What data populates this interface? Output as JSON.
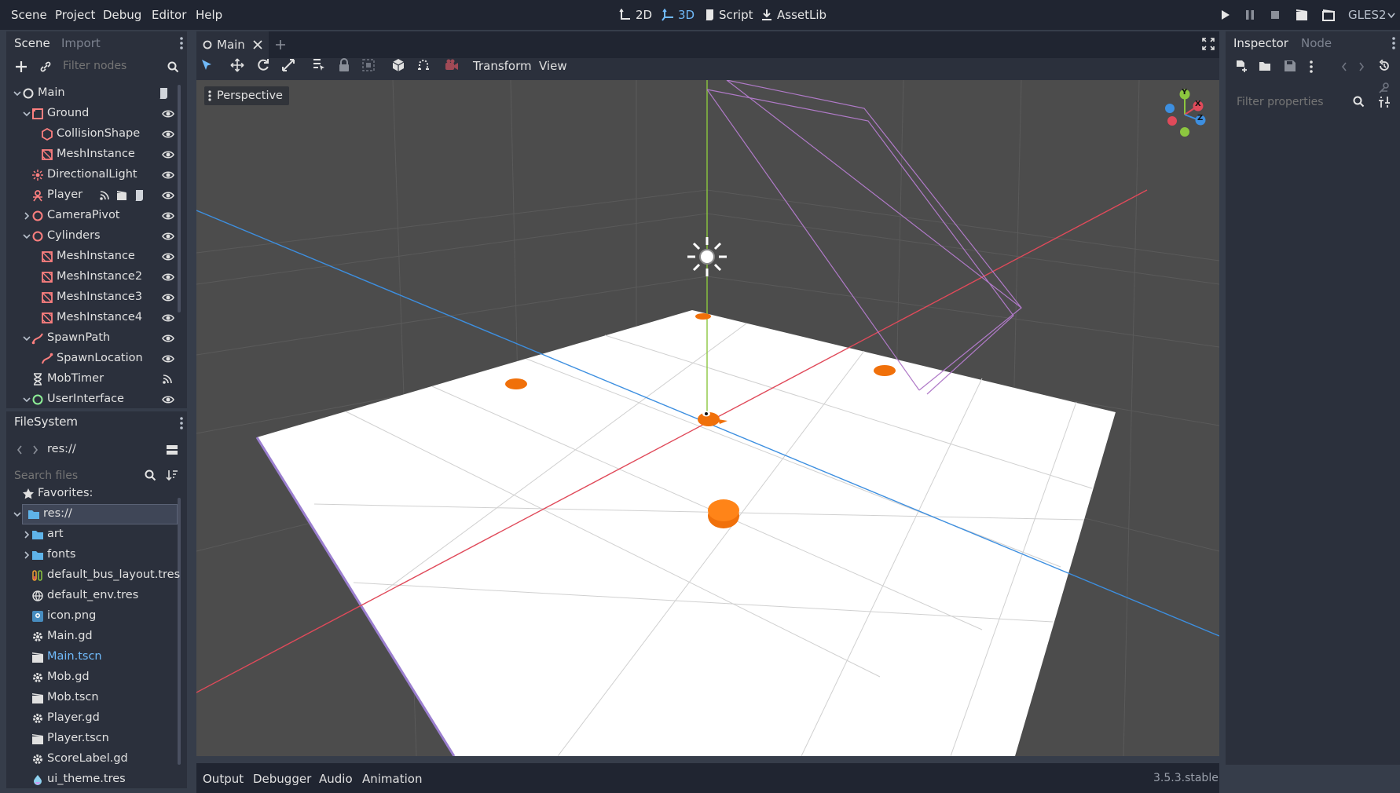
{
  "menu": {
    "items": [
      "Scene",
      "Project",
      "Debug",
      "Editor",
      "Help"
    ]
  },
  "workspaces": {
    "w2d": "2D",
    "w3d": "3D",
    "script": "Script",
    "assetlib": "AssetLib",
    "active": "3D"
  },
  "renderer": "GLES2",
  "scene_dock": {
    "tab_scene": "Scene",
    "tab_import": "Import",
    "filter_placeholder": "Filter nodes",
    "nodes": [
      {
        "label": "Main",
        "icon": "node3d-icon",
        "depth": 0,
        "expanded": true
      },
      {
        "label": "Ground",
        "icon": "static-body-icon",
        "depth": 1,
        "expanded": true
      },
      {
        "label": "CollisionShape",
        "icon": "collision-shape-icon",
        "depth": 2
      },
      {
        "label": "MeshInstance",
        "icon": "mesh-instance-icon",
        "depth": 2
      },
      {
        "label": "DirectionalLight",
        "icon": "directional-light-icon",
        "depth": 1
      },
      {
        "label": "Player",
        "icon": "player-scene-icon",
        "depth": 1
      },
      {
        "label": "CameraPivot",
        "icon": "node3d-icon",
        "depth": 1,
        "expanded": false
      },
      {
        "label": "Cylinders",
        "icon": "node3d-icon",
        "depth": 1,
        "expanded": true
      },
      {
        "label": "MeshInstance",
        "icon": "mesh-instance-icon",
        "depth": 2
      },
      {
        "label": "MeshInstance2",
        "icon": "mesh-instance-icon",
        "depth": 2
      },
      {
        "label": "MeshInstance3",
        "icon": "mesh-instance-icon",
        "depth": 2
      },
      {
        "label": "MeshInstance4",
        "icon": "mesh-instance-icon",
        "depth": 2
      },
      {
        "label": "SpawnPath",
        "icon": "path-icon",
        "depth": 1,
        "expanded": true
      },
      {
        "label": "SpawnLocation",
        "icon": "path-follow-icon",
        "depth": 2
      },
      {
        "label": "MobTimer",
        "icon": "timer-icon",
        "depth": 1
      },
      {
        "label": "UserInterface",
        "icon": "control-icon",
        "depth": 1,
        "expanded": true
      }
    ]
  },
  "filesystem": {
    "title": "FileSystem",
    "path": "res://",
    "search_placeholder": "Search files",
    "favorites": "Favorites:",
    "items": [
      {
        "label": "res://",
        "icon": "folder-icon",
        "depth": 0,
        "selected": true
      },
      {
        "label": "art",
        "icon": "folder-icon",
        "depth": 1
      },
      {
        "label": "fonts",
        "icon": "folder-icon",
        "depth": 1
      },
      {
        "label": "default_bus_layout.tres",
        "icon": "audio-bus-icon",
        "depth": 1
      },
      {
        "label": "default_env.tres",
        "icon": "environment-icon",
        "depth": 1
      },
      {
        "label": "icon.png",
        "icon": "image-icon",
        "depth": 1
      },
      {
        "label": "Main.gd",
        "icon": "gear-icon",
        "depth": 1
      },
      {
        "label": "Main.tscn",
        "icon": "clapper-icon",
        "depth": 1,
        "highlight": true
      },
      {
        "label": "Mob.gd",
        "icon": "gear-icon",
        "depth": 1
      },
      {
        "label": "Mob.tscn",
        "icon": "clapper-icon",
        "depth": 1
      },
      {
        "label": "Player.gd",
        "icon": "gear-icon",
        "depth": 1
      },
      {
        "label": "Player.tscn",
        "icon": "clapper-icon",
        "depth": 1
      },
      {
        "label": "ScoreLabel.gd",
        "icon": "gear-icon",
        "depth": 1
      },
      {
        "label": "ui_theme.tres",
        "icon": "theme-icon",
        "depth": 1
      }
    ]
  },
  "editor": {
    "scene_tab": "Main",
    "toolbar_transform": "Transform",
    "toolbar_view": "View",
    "viewport_label": "Perspective"
  },
  "gizmo": {
    "x": "X",
    "y": "Y",
    "z": "Z"
  },
  "inspector": {
    "tab_inspector": "Inspector",
    "tab_node": "Node",
    "filter_placeholder": "Filter properties"
  },
  "bottom": {
    "tabs": [
      "Output",
      "Debugger",
      "Audio",
      "Animation"
    ],
    "version": "3.5.3.stable"
  },
  "colors": {
    "accent": "#70bafa",
    "x_axis": "#e04a5a",
    "y_axis": "#8cc63f",
    "z_axis": "#3d8fe0",
    "node_icon": "#fc7f7f",
    "folder": "#5fb3e8",
    "orange": "#f0700a"
  }
}
